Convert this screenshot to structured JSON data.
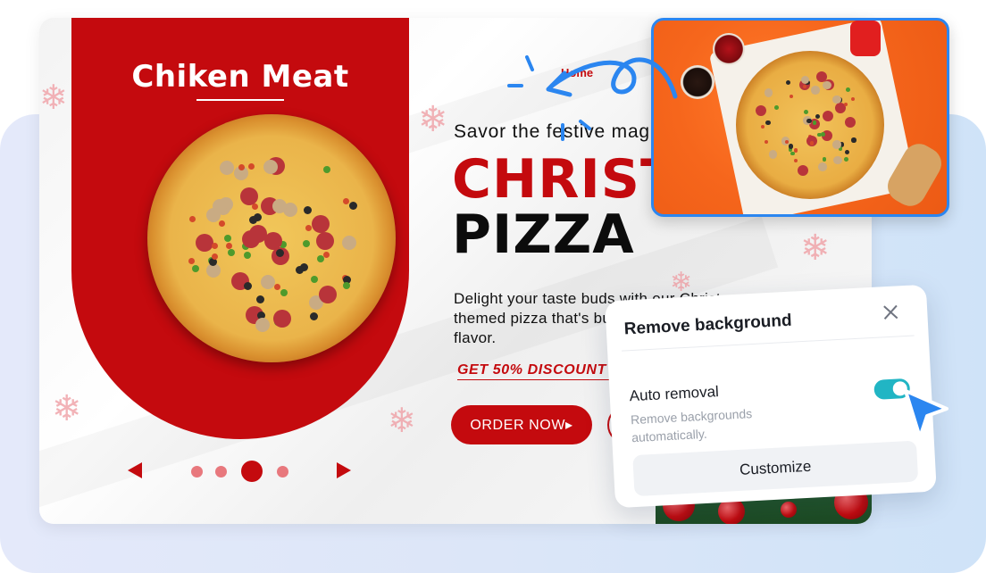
{
  "colors": {
    "brand_red": "#c40a0e",
    "accent_blue": "#2b86f0",
    "toggle_on": "#21b5c4",
    "panel_bg": "#dce6f8"
  },
  "flyer": {
    "arch_title": "Chiken Meat",
    "nav_home": "Home",
    "tagline": "Savor the festive magic",
    "headline_line1": "CHRISTMAS",
    "headline_line2": "PIZZA",
    "description": "Delight your taste buds with our Christmas themed pizza that's bursting with holiday flavor.",
    "discount": "GET 50% DISCOUNT",
    "order_button": "ORDER NOW▸",
    "carousel": {
      "dot_count": 4,
      "active_index": 2
    }
  },
  "modal": {
    "title": "Remove background",
    "option_label": "Auto removal",
    "option_description": "Remove backgrounds automatically.",
    "toggle_on": true,
    "customize_button": "Customize"
  },
  "icons": {
    "close": "close-icon",
    "snowflake": "snowflake-icon",
    "cursor": "pointer-cursor-icon",
    "arrow": "curved-arrow-icon",
    "prev": "arrow-left-icon",
    "next": "arrow-right-icon"
  }
}
